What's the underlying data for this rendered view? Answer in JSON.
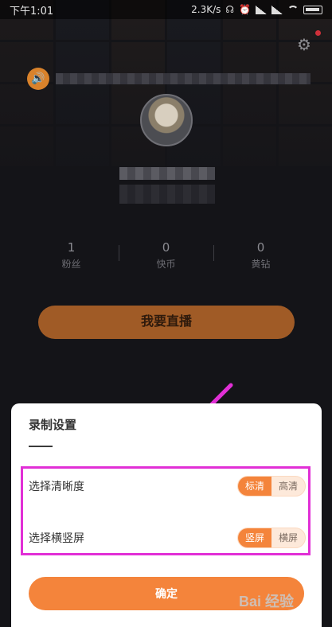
{
  "status_bar": {
    "time": "下午1:01",
    "net_speed": "2.3K/s"
  },
  "profile": {
    "stats": [
      {
        "value": "1",
        "label": "粉丝"
      },
      {
        "value": "0",
        "label": "快币"
      },
      {
        "value": "0",
        "label": "黄钻"
      }
    ],
    "live_button": "我要直播"
  },
  "sheet": {
    "title": "录制设置",
    "quality": {
      "label": "选择清晰度",
      "options": [
        "标清",
        "高清"
      ],
      "selected": "标清"
    },
    "orientation": {
      "label": "选择横竖屏",
      "options": [
        "竖屏",
        "横屏"
      ],
      "selected": "竖屏"
    },
    "confirm": "确定"
  },
  "watermark": "Bai 经验",
  "colors": {
    "accent": "#f4843b",
    "highlight": "#e12fd6"
  },
  "icons": [
    "settings-gear-icon",
    "speaker-icon",
    "signal-icon",
    "wifi-icon",
    "battery-icon",
    "headphones-icon",
    "alarm-icon"
  ]
}
